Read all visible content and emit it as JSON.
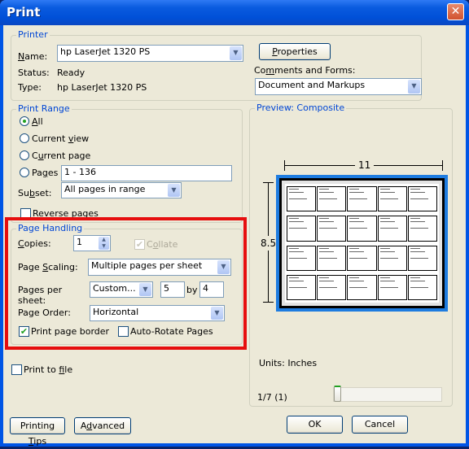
{
  "window": {
    "title": "Print",
    "close_icon": "✕"
  },
  "printer": {
    "group_label": "Printer",
    "name_label": "Name:",
    "name_value": "hp LaserJet 1320 PS",
    "status_label": "Status:",
    "status_value": "Ready",
    "type_label": "Type:",
    "type_value": "hp LaserJet 1320 PS",
    "properties_button": "Properties",
    "comments_label": "Comments and Forms:",
    "comments_value": "Document and Markups"
  },
  "print_range": {
    "group_label": "Print Range",
    "options": [
      {
        "label": "All",
        "selected": true
      },
      {
        "label": "Current view",
        "selected": false
      },
      {
        "label": "Current page",
        "selected": false
      },
      {
        "label": "Pages",
        "selected": false
      }
    ],
    "pages_value": "1 - 136",
    "subset_label": "Subset:",
    "subset_value": "All pages in range",
    "reverse_label": "Reverse pages",
    "reverse_checked": false
  },
  "page_handling": {
    "group_label": "Page Handling",
    "copies_label": "Copies:",
    "copies_value": "1",
    "collate_label": "Collate",
    "collate_checked": true,
    "collate_enabled": false,
    "scaling_label": "Page Scaling:",
    "scaling_value": "Multiple pages per sheet",
    "pps_label_1": "Pages per",
    "pps_label_2": "sheet:",
    "pps_value": "Custom...",
    "pps_cols": "5",
    "by_label": "by",
    "pps_rows": "4",
    "order_label": "Page Order:",
    "order_value": "Horizontal",
    "border_label": "Print page border",
    "border_checked": true,
    "autorotate_label": "Auto-Rotate Pages",
    "autorotate_checked": false
  },
  "print_to_file": {
    "label": "Print to file",
    "checked": false
  },
  "preview": {
    "group_label": "Preview: Composite",
    "width_label": "11",
    "height_label": "8.5",
    "units_label": "Units: Inches",
    "page_indicator": "1/7 (1)",
    "slider_position": 0,
    "grid_cols": 5,
    "grid_rows": 4
  },
  "buttons": {
    "printing_tips": "Printing Tips",
    "advanced": "Advanced",
    "ok": "OK",
    "cancel": "Cancel"
  },
  "colors": {
    "highlight_box": "#e60e0e",
    "preview_frame": "#1e7ce0",
    "group_label": "#0046d5"
  }
}
